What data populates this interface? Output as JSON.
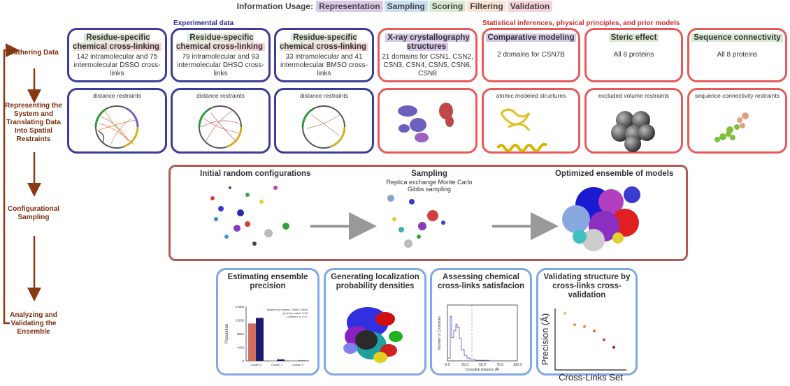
{
  "legend": {
    "prefix": "Information Usage:",
    "items": [
      {
        "label": "Representation",
        "color": "#d9c9e8"
      },
      {
        "label": "Sampling",
        "color": "#c9dff2"
      },
      {
        "label": "Scoring",
        "color": "#d9ead3"
      },
      {
        "label": "Filtering",
        "color": "#fbe3d3"
      },
      {
        "label": "Validation",
        "color": "#f5d3d9"
      }
    ]
  },
  "stages": {
    "gathering": "Gathering Data",
    "representing": "Representing the System and Translating Data Into Spatial Restraints",
    "sampling": "Configurational Sampling",
    "analyzing": "Analyzing and Validating the Ensemble"
  },
  "headers": {
    "experimental": "Experimental data",
    "statistical": "Statistical inferences, physical principles, and prior models"
  },
  "row1": [
    {
      "title": "Residue-specific chemical cross-linking",
      "text": "142 intramolecular and 75 intermolecular DSSO cross-links"
    },
    {
      "title": "Residue-specific chemical cross-linking",
      "text": "79 intramolecular and 93 intermolecular DHSO cross-links"
    },
    {
      "title": "Residue-specific chemical cross-linking",
      "text": "33 intramolecular and 41 intermolecular BMSO cross-links"
    },
    {
      "title": "X-ray crystallography structures",
      "text": "21 domains for CSN1, CSN2, CSN3, CSN4, CSN5, CSN6, CSN8"
    },
    {
      "title": "Comparative modeling",
      "text": "2 domains for CSN7B"
    },
    {
      "title": "Steric effect",
      "text": "All 8 proteins"
    },
    {
      "title": "Sequence connectivity",
      "text": "All 8 proteins"
    }
  ],
  "row2": [
    {
      "label": "distance restraints"
    },
    {
      "label": "distance restraints"
    },
    {
      "label": "distance restraints"
    },
    {
      "label": ""
    },
    {
      "label": "atomic modeled structures"
    },
    {
      "label": "excluded volume restraints"
    },
    {
      "label": "sequence connectivity restraints"
    }
  ],
  "sampling_box": {
    "initial": "Initial random configurations",
    "sampling_title": "Sampling",
    "sampling_sub1": "Replica exchange Monte Carlo",
    "sampling_sub2": "Gibbs sampling",
    "optimized": "Optimized ensemble of models"
  },
  "analysis": [
    {
      "title": "Estimating ensemble precision"
    },
    {
      "title": "Generating localization probability densities"
    },
    {
      "title": "Assessing chemical cross-links satisfacion"
    },
    {
      "title": "Validating structure by cross-links cross-validation"
    }
  ],
  "precision_chart": {
    "ylabel": "Population",
    "yticks": [
      "17606",
      "13205",
      "8804",
      "4403",
      "0"
    ],
    "categories": [
      "Cluster 0",
      "Cluster 1",
      "Cluster 2"
    ],
    "stats": [
      "Number of models: 19985 13640",
      "χ²-test p-value: 0.00",
      "Cramer's V: 0.07"
    ],
    "series": [
      {
        "values": [
          12100,
          80,
          40
        ],
        "color": "#cf6d60"
      },
      {
        "values": [
          13900,
          500,
          120
        ],
        "color": "#1a1a6e"
      }
    ],
    "ymax": 17606
  },
  "xl_chart": {
    "ylabel": "Number of Crosslinks",
    "xlabel": "Crosslink distance (Å)",
    "xticks": [
      "0.0",
      "25.0",
      "50.0",
      "75.0",
      "100.0"
    ],
    "threshold": 35
  },
  "cv_chart": {
    "ylabel": "Precision (Å)",
    "xlabel": "Cross-Links Set",
    "points": [
      {
        "x": 1,
        "y": 9.0,
        "color": "#f2c14e"
      },
      {
        "x": 2,
        "y": 7.2,
        "color": "#ef9a3a"
      },
      {
        "x": 3,
        "y": 6.9,
        "color": "#ec8a36"
      },
      {
        "x": 4,
        "y": 6.2,
        "color": "#e46a2e"
      },
      {
        "x": 5,
        "y": 4.8,
        "color": "#d9442a"
      },
      {
        "x": 6,
        "y": 3.6,
        "color": "#b01818"
      }
    ]
  }
}
